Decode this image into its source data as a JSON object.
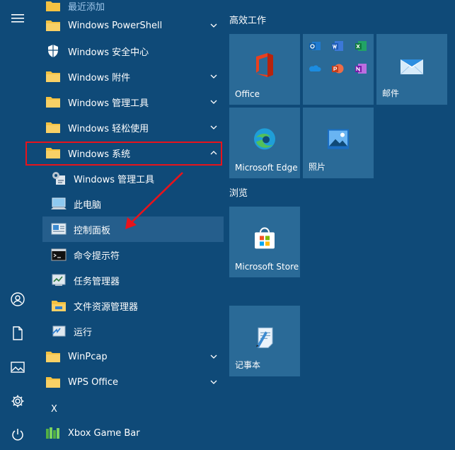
{
  "rail": {
    "menu_icon": "hamburger-icon",
    "user_icon": "user-icon",
    "documents_icon": "document-icon",
    "pictures_icon": "pictures-icon",
    "settings_icon": "gear-icon",
    "power_icon": "power-icon"
  },
  "apps": {
    "recently_added": "最近添加",
    "items": [
      {
        "label": "Windows PowerShell",
        "icon": "folder-icon"
      },
      {
        "label": "Windows 安全中心",
        "icon": "shield-icon"
      },
      {
        "label": "Windows 附件",
        "icon": "folder-icon"
      },
      {
        "label": "Windows 管理工具",
        "icon": "folder-icon"
      },
      {
        "label": "Windows 轻松使用",
        "icon": "folder-icon"
      },
      {
        "label": "Windows 系统",
        "icon": "folder-icon"
      }
    ],
    "system_items": [
      {
        "label": "Windows 管理工具",
        "icon": "admin-tools-icon"
      },
      {
        "label": "此电脑",
        "icon": "computer-icon"
      },
      {
        "label": "控制面板",
        "icon": "control-panel-icon"
      },
      {
        "label": "命令提示符",
        "icon": "cmd-icon"
      },
      {
        "label": "任务管理器",
        "icon": "task-manager-icon"
      },
      {
        "label": "文件资源管理器",
        "icon": "file-explorer-icon"
      },
      {
        "label": "运行",
        "icon": "run-icon"
      }
    ],
    "more_items": [
      {
        "label": "WinPcap",
        "icon": "folder-icon"
      },
      {
        "label": "WPS Office",
        "icon": "folder-icon"
      }
    ],
    "letter_x": "X",
    "xbox": {
      "label": "Xbox Game Bar",
      "icon": "xbox-game-bar-icon"
    }
  },
  "tiles": {
    "group1_title": "高效工作",
    "group2_title": "浏览",
    "office": "Office",
    "mail": "邮件",
    "edge": "Microsoft Edge",
    "photos": "照片",
    "store": "Microsoft Store",
    "notepad": "记事本"
  },
  "colors": {
    "background": "#0f4a78",
    "tile": "#2a6a97",
    "highlight": "#255e8c",
    "annotation": "#e8131b",
    "folder": "#f4c242"
  }
}
